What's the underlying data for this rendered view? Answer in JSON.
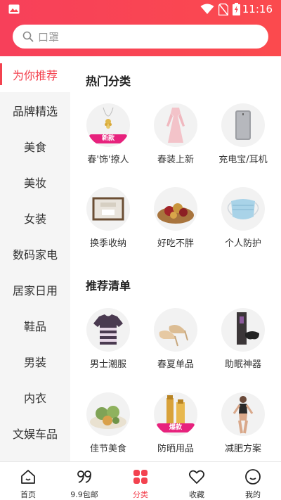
{
  "statusbar": {
    "time": "11:16"
  },
  "search": {
    "placeholder": "口罩"
  },
  "sidebar": {
    "items": [
      {
        "label": "为你推荐",
        "active": true
      },
      {
        "label": "品牌精选"
      },
      {
        "label": "美食"
      },
      {
        "label": "美妆"
      },
      {
        "label": "女装"
      },
      {
        "label": "数码家电"
      },
      {
        "label": "居家日用"
      },
      {
        "label": "鞋品"
      },
      {
        "label": "男装"
      },
      {
        "label": "内衣"
      },
      {
        "label": "文娱车品"
      }
    ]
  },
  "sections": {
    "hot": {
      "title": "热门分类",
      "items": [
        {
          "label": "春'饰'撩人",
          "icon": "necklace-icon",
          "badge": "新款"
        },
        {
          "label": "春装上新",
          "icon": "dress-icon"
        },
        {
          "label": "充电宝/耳机",
          "icon": "power-bank-icon"
        },
        {
          "label": "换季收纳",
          "icon": "storage-box-icon"
        },
        {
          "label": "好吃不胖",
          "icon": "dried-fruit-icon"
        },
        {
          "label": "个人防护",
          "icon": "face-mask-icon"
        }
      ]
    },
    "list": {
      "title": "推荐清单",
      "items": [
        {
          "label": "男士潮服",
          "icon": "tshirt-icon"
        },
        {
          "label": "春夏单品",
          "icon": "heels-icon"
        },
        {
          "label": "助眠神器",
          "icon": "sleep-mask-icon"
        },
        {
          "label": "佳节美食",
          "icon": "dumplings-icon"
        },
        {
          "label": "防晒用品",
          "icon": "sunscreen-icon",
          "badge": "爆款"
        },
        {
          "label": "减肥方案",
          "icon": "fitness-woman-icon"
        }
      ]
    }
  },
  "tabbar": {
    "items": [
      {
        "label": "首页",
        "icon": "home-icon"
      },
      {
        "label": "9.9包邮",
        "icon": "nine-nine-icon"
      },
      {
        "label": "分类",
        "icon": "category-icon",
        "active": true
      },
      {
        "label": "收藏",
        "icon": "heart-icon"
      },
      {
        "label": "我的",
        "icon": "profile-icon"
      }
    ]
  },
  "colors": {
    "accent": "#f3424f",
    "header": "#f8434f",
    "sidebar_bg": "#f5f5f5"
  }
}
